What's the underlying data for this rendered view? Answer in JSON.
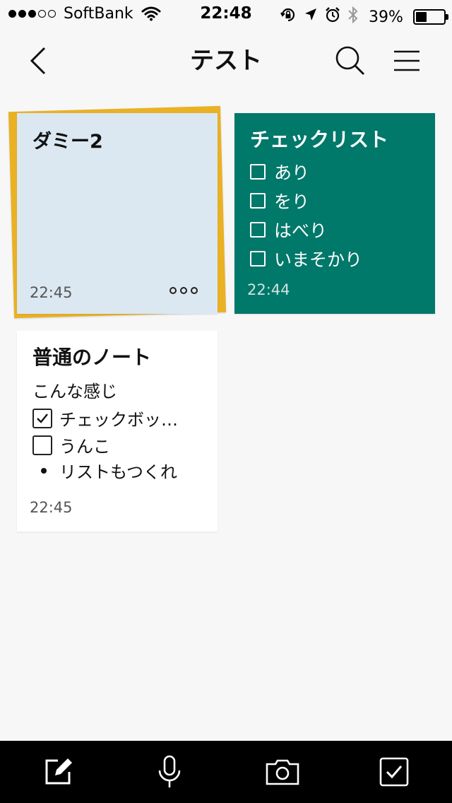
{
  "status_bar": {
    "carrier": "SoftBank",
    "time": "22:48",
    "battery_percent": "39%",
    "battery_level": 0.39
  },
  "nav": {
    "title": "テスト",
    "back_icon": "chevron-left-icon",
    "search_icon": "search-icon",
    "menu_icon": "menu-icon"
  },
  "notes": [
    {
      "title": "ダミー2",
      "time": "22:45",
      "background": "#dbe8f1",
      "stack_color": "#e9b124"
    },
    {
      "title": "チェックリスト",
      "time": "22:44",
      "background": "#00786a",
      "items": [
        "あり",
        "をり",
        "はべり",
        "いまそかり"
      ]
    },
    {
      "title": "普通のノート",
      "time": "22:45",
      "body": "こんな感じ",
      "checks": [
        {
          "label": "チェックボッ…",
          "checked": true
        },
        {
          "label": "うんこ",
          "checked": false
        }
      ],
      "bullets": [
        "リストもつくれ"
      ]
    }
  ],
  "toolbar": {
    "items": [
      "new-note-icon",
      "microphone-icon",
      "camera-icon",
      "checkbox-icon"
    ]
  }
}
